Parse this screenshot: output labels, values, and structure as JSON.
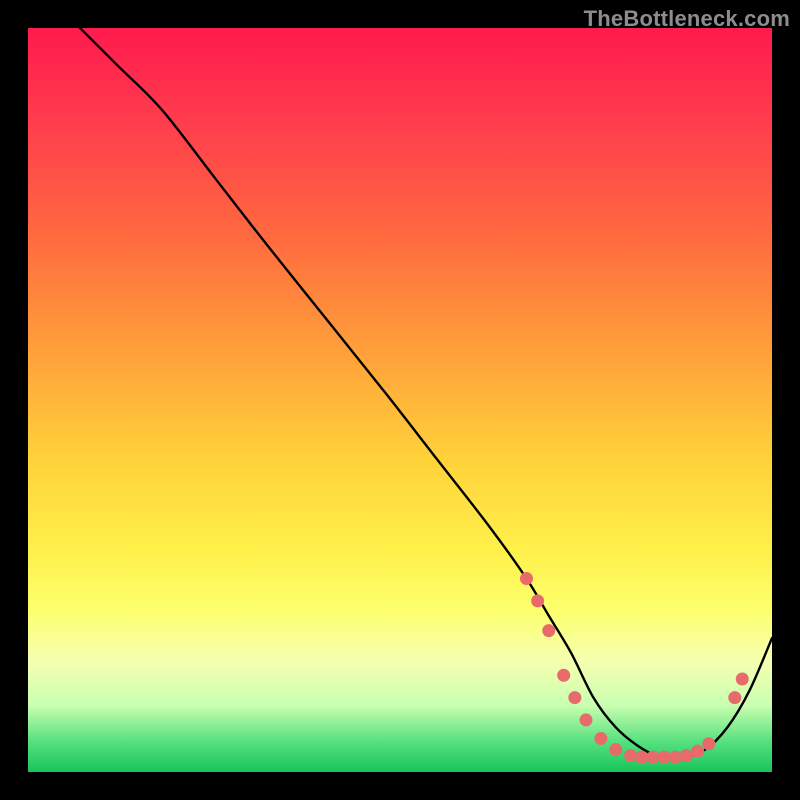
{
  "watermark": {
    "text": "TheBottleneck.com"
  },
  "chart_data": {
    "type": "line",
    "title": "",
    "xlabel": "",
    "ylabel": "",
    "xlim": [
      0,
      100
    ],
    "ylim": [
      0,
      100
    ],
    "grid": false,
    "legend": false,
    "series": [
      {
        "name": "curve",
        "x": [
          7,
          12,
          18,
          25,
          32,
          40,
          48,
          55,
          62,
          67,
          70,
          73,
          76,
          79,
          82,
          85,
          88,
          91,
          94,
          97,
          100
        ],
        "y": [
          100,
          95,
          89,
          80,
          71,
          61,
          51,
          42,
          33,
          26,
          21,
          16,
          10,
          6,
          3.5,
          2,
          2,
          3,
          6,
          11,
          18
        ]
      }
    ],
    "markers": [
      {
        "x": 67,
        "y": 26
      },
      {
        "x": 68.5,
        "y": 23
      },
      {
        "x": 70,
        "y": 19
      },
      {
        "x": 72,
        "y": 13
      },
      {
        "x": 73.5,
        "y": 10
      },
      {
        "x": 75,
        "y": 7
      },
      {
        "x": 77,
        "y": 4.5
      },
      {
        "x": 79,
        "y": 3
      },
      {
        "x": 81,
        "y": 2.2
      },
      {
        "x": 82.5,
        "y": 2
      },
      {
        "x": 84,
        "y": 2
      },
      {
        "x": 85.5,
        "y": 2
      },
      {
        "x": 87,
        "y": 2
      },
      {
        "x": 88.5,
        "y": 2.2
      },
      {
        "x": 90,
        "y": 2.8
      },
      {
        "x": 91.5,
        "y": 3.8
      },
      {
        "x": 95,
        "y": 10
      },
      {
        "x": 96,
        "y": 12.5
      }
    ],
    "colors": {
      "curve_stroke": "#000000",
      "marker_fill": "#e76b6b"
    }
  }
}
